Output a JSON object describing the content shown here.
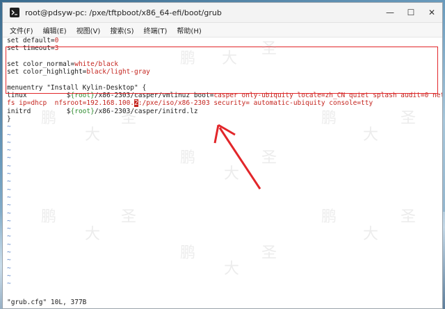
{
  "window": {
    "title": "root@pdsyw-pc: /pxe/tftpboot/x86_64-efi/boot/grub",
    "min_glyph": "—",
    "max_glyph": "☐",
    "close_glyph": "✕"
  },
  "menu": [
    "文件(F)",
    "编辑(E)",
    "视图(V)",
    "搜索(S)",
    "终端(T)",
    "帮助(H)"
  ],
  "editor": {
    "l1_kw": "set default=",
    "l1_val": "0",
    "l2_kw": "set timeout=",
    "l2_val": "3",
    "l4_kw": "set color_normal=",
    "l4_val": "white/black",
    "l5_kw": "set color_highlight=",
    "l5_val": "black/light-gray",
    "l7": "menuentry \"Install Kylin-Desktop\" {",
    "l8_a": "linux          $",
    "l8_var": "{root}",
    "l8_b": "/x86-2303/casper/vmlinuz boot=",
    "l8_c": "casper only-ubiquity locale=zh_CN quiet splash audit=0 netboot=n",
    "l9_a": "fs ip=dhcp  nfsroot=192.168.100.",
    "l9_cursor": "2",
    "l9_b": ":/pxe/iso/x86-2303 security= automatic-ubiquity console=tty",
    "l10_a": "initrd         $",
    "l10_var": "{root}",
    "l10_b": "/x86-2303/casper/initrd.lz",
    "l11": "}",
    "tilde": "~"
  },
  "status": "\"grub.cfg\" 10L, 377B",
  "watermark": {
    "a": "鹏",
    "b": "大",
    "c": "圣"
  },
  "annotation_color": "#e2262a"
}
